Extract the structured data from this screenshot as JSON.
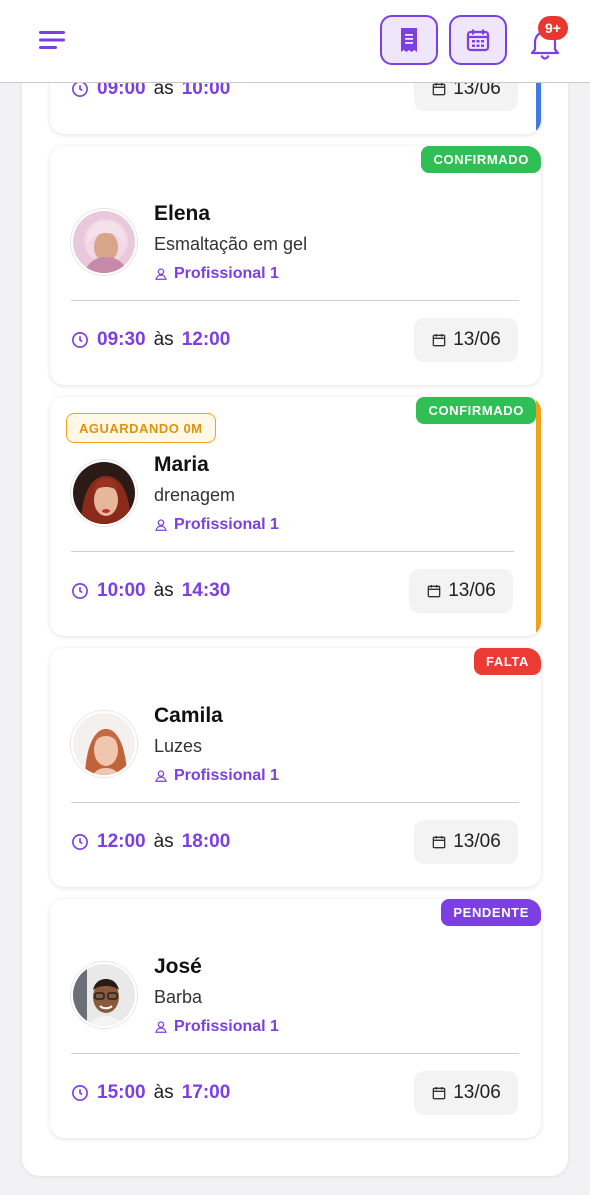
{
  "header": {
    "notification_count": "9+",
    "colors": {
      "accent": "#7b3fe4",
      "accent_bg": "#efe6fc",
      "badge": "#e8372f"
    }
  },
  "appointments": [
    {
      "name": "",
      "service": "",
      "professional": "",
      "start": "09:00",
      "separator": "às",
      "end": "10:00",
      "date": "13/06",
      "status": "",
      "waiting": "",
      "accent": "blue"
    },
    {
      "name": "Elena",
      "service": "Esmaltação em gel",
      "professional": "Profissional 1",
      "start": "09:30",
      "separator": "às",
      "end": "12:00",
      "date": "13/06",
      "status": "CONFIRMADO",
      "status_color": "#2fbf55",
      "waiting": ""
    },
    {
      "name": "Maria",
      "service": "drenagem",
      "professional": "Profissional 1",
      "start": "10:00",
      "separator": "às",
      "end": "14:30",
      "date": "13/06",
      "status": "CONFIRMADO",
      "status_color": "#2fbf55",
      "waiting": "AGUARDANDO 0M",
      "accent": "orange"
    },
    {
      "name": "Camila",
      "service": "Luzes",
      "professional": "Profissional 1",
      "start": "12:00",
      "separator": "às",
      "end": "18:00",
      "date": "13/06",
      "status": "FALTA",
      "status_color": "#ec3b35",
      "waiting": ""
    },
    {
      "name": "José",
      "service": "Barba",
      "professional": "Profissional 1",
      "start": "15:00",
      "separator": "às",
      "end": "17:00",
      "date": "13/06",
      "status": "PENDENTE",
      "status_color": "#7b3fe4",
      "waiting": ""
    }
  ]
}
